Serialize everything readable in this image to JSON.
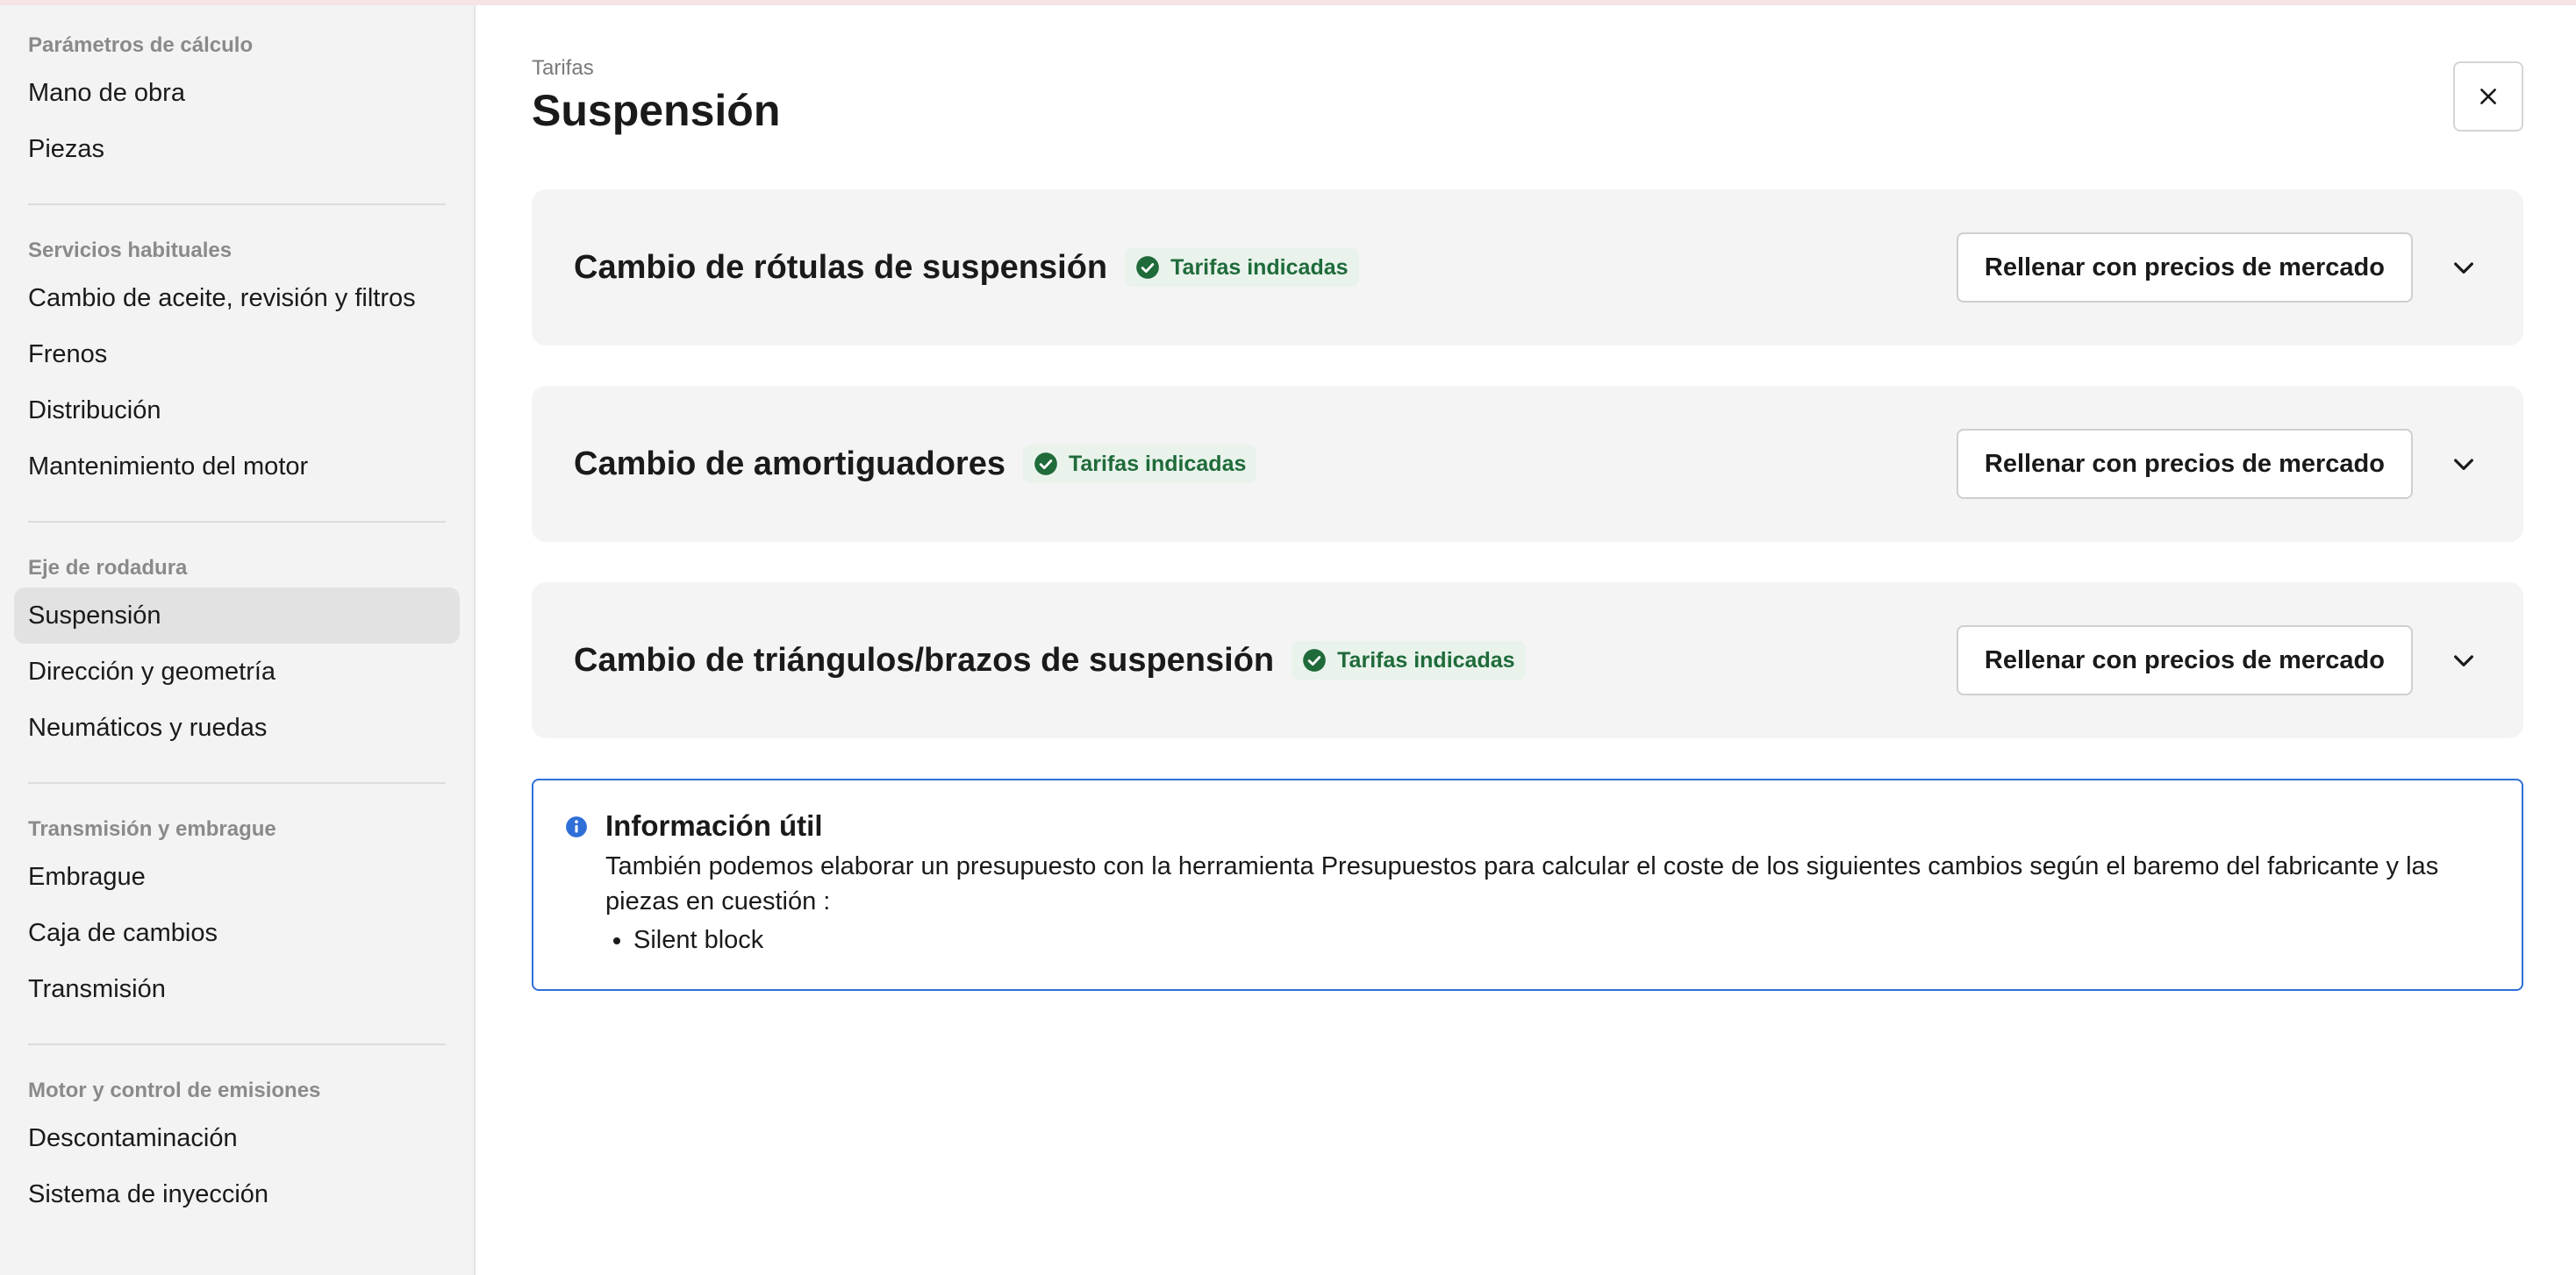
{
  "colors": {
    "accent_blue": "#2f6fd8",
    "success_green": "#1f6b3a",
    "badge_bg": "#e9f3ec",
    "sidebar_bg": "#f3f3f3"
  },
  "sidebar": {
    "groups": [
      {
        "title": "Parámetros de cálculo",
        "items": [
          "Mano de obra",
          "Piezas"
        ]
      },
      {
        "title": "Servicios habituales",
        "items": [
          "Cambio de aceite, revisión y filtros",
          "Frenos",
          "Distribución",
          "Mantenimiento del motor"
        ]
      },
      {
        "title": "Eje de rodadura",
        "items": [
          "Suspensión",
          "Dirección y geometría",
          "Neumáticos y ruedas"
        ]
      },
      {
        "title": "Transmisión y embrague",
        "items": [
          "Embrague",
          "Caja de cambios",
          "Transmisión"
        ]
      },
      {
        "title": "Motor y control de emisiones",
        "items": [
          "Descontaminación",
          "Sistema de inyección"
        ]
      }
    ],
    "active_item": "Suspensión"
  },
  "header": {
    "breadcrumb": "Tarifas",
    "title": "Suspensión",
    "close_icon": "close-icon"
  },
  "sections": [
    {
      "title": "Cambio de rótulas de suspensión",
      "badge": "Tarifas indicadas",
      "button": "Rellenar con precios de mercado"
    },
    {
      "title": "Cambio de amortiguadores",
      "badge": "Tarifas indicadas",
      "button": "Rellenar con precios de mercado"
    },
    {
      "title": "Cambio de triángulos/brazos de suspensión",
      "badge": "Tarifas indicadas",
      "button": "Rellenar con precios de mercado"
    }
  ],
  "info": {
    "title": "Información útil",
    "text": "También podemos elaborar un presupuesto con la herramienta Presupuestos para calcular el coste de los siguientes cambios según el baremo del fabricante y las piezas en cuestión :",
    "items": [
      "Silent block"
    ]
  }
}
